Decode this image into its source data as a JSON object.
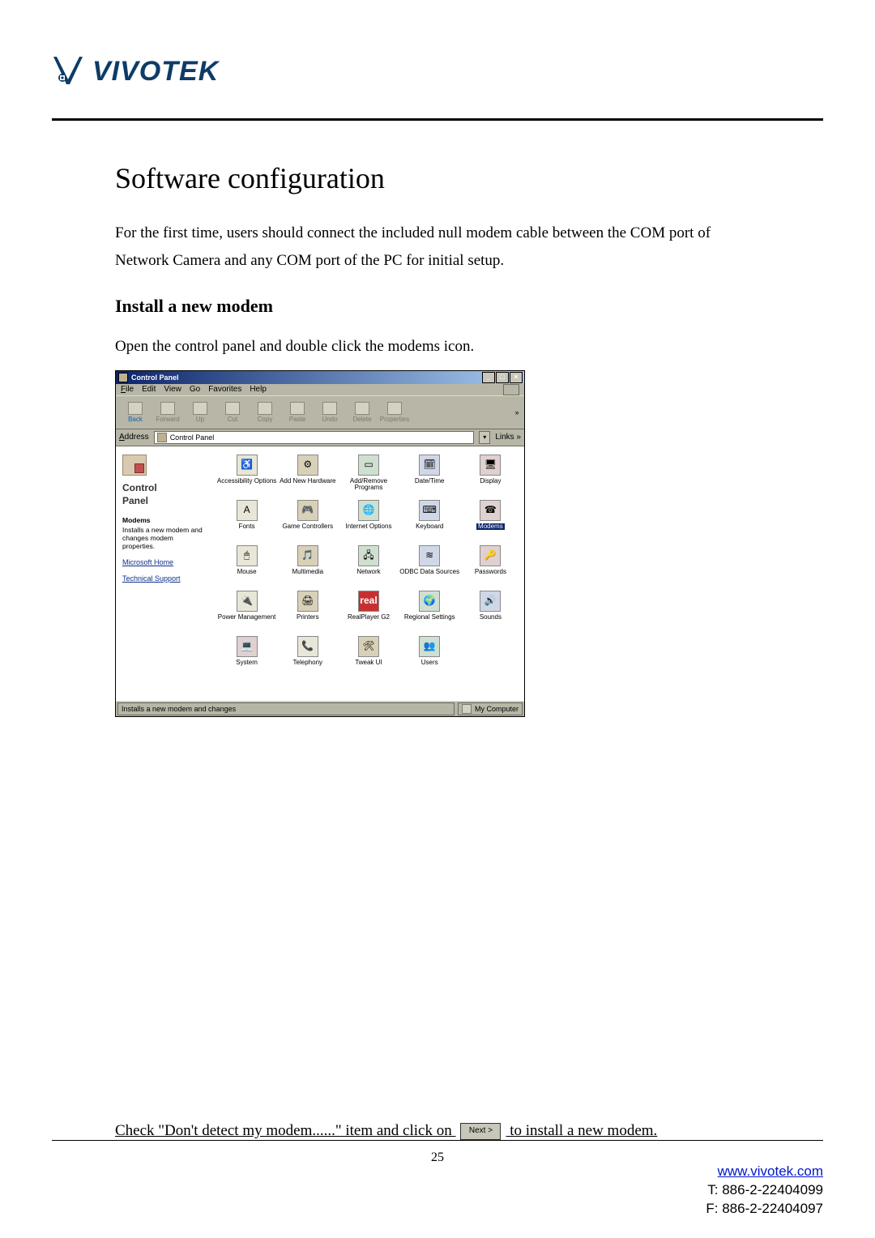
{
  "logo": {
    "text": "VIVOTEK"
  },
  "h1": "Software configuration",
  "intro": "For the first time, users should connect the included null modem cable between the COM port of Network Camera and any COM port of the PC for initial setup.",
  "h2": "Install a new modem",
  "step1": "Open the control panel and double click the modems icon.",
  "window": {
    "title": "Control Panel",
    "min": "_",
    "max": "□",
    "close": "×",
    "menu": {
      "file": "File",
      "edit": "Edit",
      "view": "View",
      "go": "Go",
      "favorites": "Favorites",
      "help": "Help"
    },
    "toolbar": {
      "back": "Back",
      "forward": "Forward",
      "up": "Up",
      "cut": "Cut",
      "copy": "Copy",
      "paste": "Paste",
      "undo": "Undo",
      "delete": "Delete",
      "properties": "Properties"
    },
    "address_label": "Address",
    "address_value": "Control Panel",
    "links_label": "Links »",
    "left": {
      "title1": "Control",
      "title2": "Panel",
      "itemname": "Modems",
      "itemdesc": "Installs a new modem and changes modem properties.",
      "link1": "Microsoft Home",
      "link2": "Technical Support"
    },
    "items": [
      {
        "label": "Accessibility Options"
      },
      {
        "label": "Add New Hardware"
      },
      {
        "label": "Add/Remove Programs"
      },
      {
        "label": "Date/Time"
      },
      {
        "label": "Display"
      },
      {
        "label": "Fonts"
      },
      {
        "label": "Game Controllers"
      },
      {
        "label": "Internet Options"
      },
      {
        "label": "Keyboard"
      },
      {
        "label": "Modems"
      },
      {
        "label": "Mouse"
      },
      {
        "label": "Multimedia"
      },
      {
        "label": "Network"
      },
      {
        "label": "ODBC Data Sources"
      },
      {
        "label": "Passwords"
      },
      {
        "label": "Power Management"
      },
      {
        "label": "Printers"
      },
      {
        "label": "RealPlayer G2"
      },
      {
        "label": "Regional Settings"
      },
      {
        "label": "Sounds"
      },
      {
        "label": "System"
      },
      {
        "label": "Telephony"
      },
      {
        "label": "Tweak UI"
      },
      {
        "label": "Users"
      }
    ],
    "status_left": "Installs a new modem and changes",
    "status_right": "My Computer"
  },
  "step2": {
    "pre": "Check \"Don't detect my modem......\" item and click on ",
    "button": "Next >",
    "post": " to install a new modem."
  },
  "page_number": "25",
  "footer": {
    "url": "www.vivotek.com",
    "tel": "T: 886-2-22404099",
    "fax": "F: 886-2-22404097"
  }
}
